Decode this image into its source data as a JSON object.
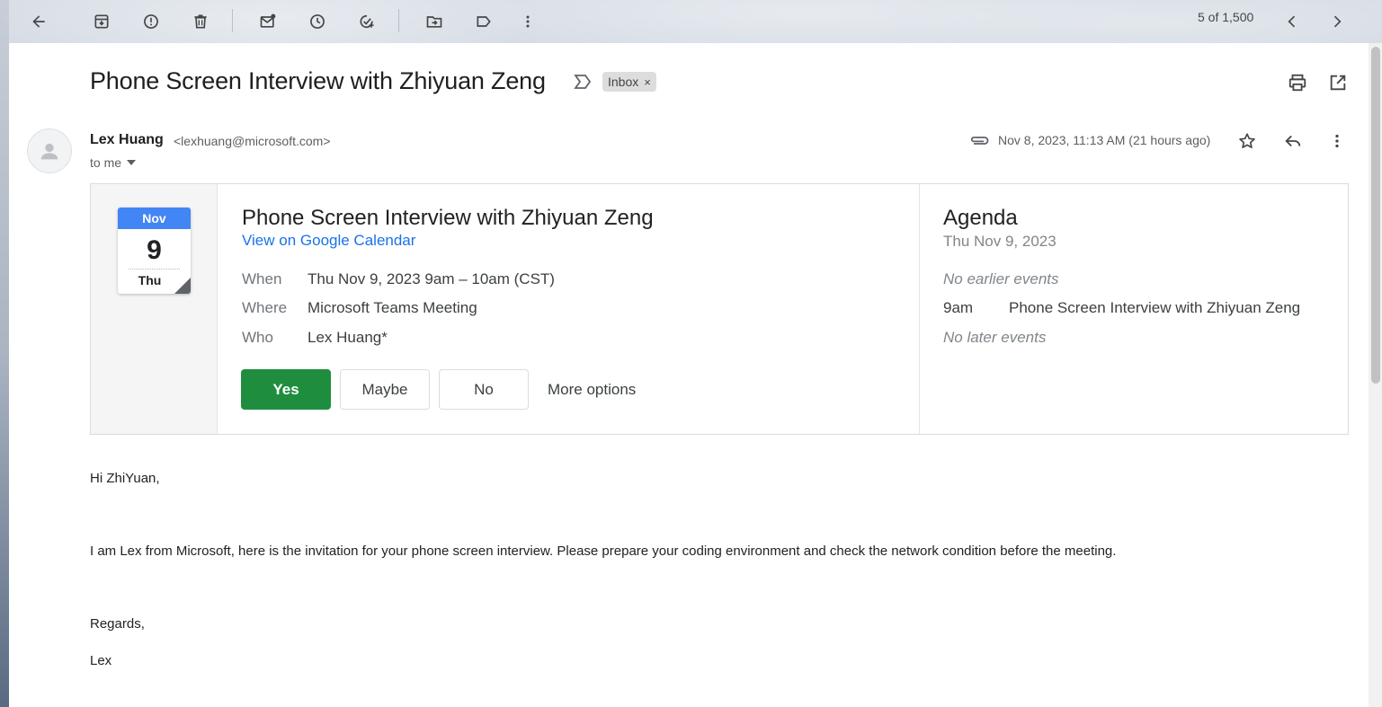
{
  "toolbar": {
    "pager": "5 of 1,500",
    "icons": [
      "back-icon",
      "archive-icon",
      "report-spam-icon",
      "delete-icon",
      "mark-unread-icon",
      "snooze-icon",
      "add-to-tasks-icon",
      "move-to-icon",
      "labels-icon",
      "more-vert-icon",
      "prev-icon",
      "next-icon"
    ]
  },
  "message": {
    "subject": "Phone Screen Interview with Zhiyuan Zeng",
    "label_chip": "Inbox",
    "label_chip_close": "×",
    "sender_name": "Lex Huang",
    "sender_email": "<lexhuang@microsoft.com>",
    "to_me": "to me",
    "date": "Nov 8, 2023, 11:13 AM (21 hours ago)"
  },
  "invite": {
    "month": "Nov",
    "day": "9",
    "weekday": "Thu",
    "title": "Phone Screen Interview with Zhiyuan Zeng",
    "link": "View on Google Calendar",
    "when_label": "When",
    "when_value": "Thu Nov 9, 2023 9am – 10am (CST)",
    "where_label": "Where",
    "where_value": "Microsoft Teams Meeting",
    "who_label": "Who",
    "who_value": "Lex Huang*",
    "yes": "Yes",
    "maybe": "Maybe",
    "no": "No",
    "more_options": "More options"
  },
  "agenda": {
    "title": "Agenda",
    "date": "Thu Nov 9, 2023",
    "no_earlier": "No earlier events",
    "time": "9am",
    "event": "Phone Screen Interview with Zhiyuan Zeng",
    "no_later": "No later events"
  },
  "body": {
    "greeting": "Hi ZhiYuan,",
    "paragraph": "I am Lex from Microsoft, here is the invitation for your phone screen interview. Please prepare your coding environment and check the network condition before the meeting.",
    "regards": "Regards,",
    "signature": "Lex"
  },
  "colors": {
    "yes_button": "#1e8e3e",
    "calendar_header": "#4285f4",
    "link": "#1a73e8"
  }
}
